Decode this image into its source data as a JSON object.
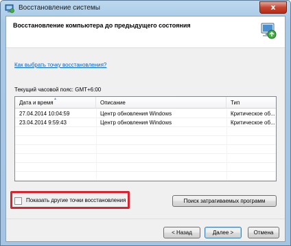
{
  "window": {
    "title": "Восстановление системы",
    "close_glyph": "x"
  },
  "header": {
    "title": "Восстановление компьютера до предыдущего состояния"
  },
  "help_link": "Как выбрать точку восстановления?",
  "timezone": "Текущий часовой пояс: GMT+6:00",
  "table": {
    "columns": [
      "Дата и время",
      "Описание",
      "Тип"
    ],
    "rows": [
      [
        "27.04.2014 10:04:59",
        "Центр обновления Windows",
        "Критическое об..."
      ],
      [
        "23.04.2014 9:59:43",
        "Центр обновления Windows",
        "Критическое об..."
      ]
    ]
  },
  "show_more_checkbox": {
    "label": "Показать другие точки восстановления",
    "checked": false
  },
  "buttons": {
    "scan": "Поиск затрагиваемых программ",
    "back": "< Назад",
    "next": "Далее >",
    "cancel": "Отмена"
  },
  "colors": {
    "highlight": "#d9232e",
    "link": "#0066cc"
  }
}
